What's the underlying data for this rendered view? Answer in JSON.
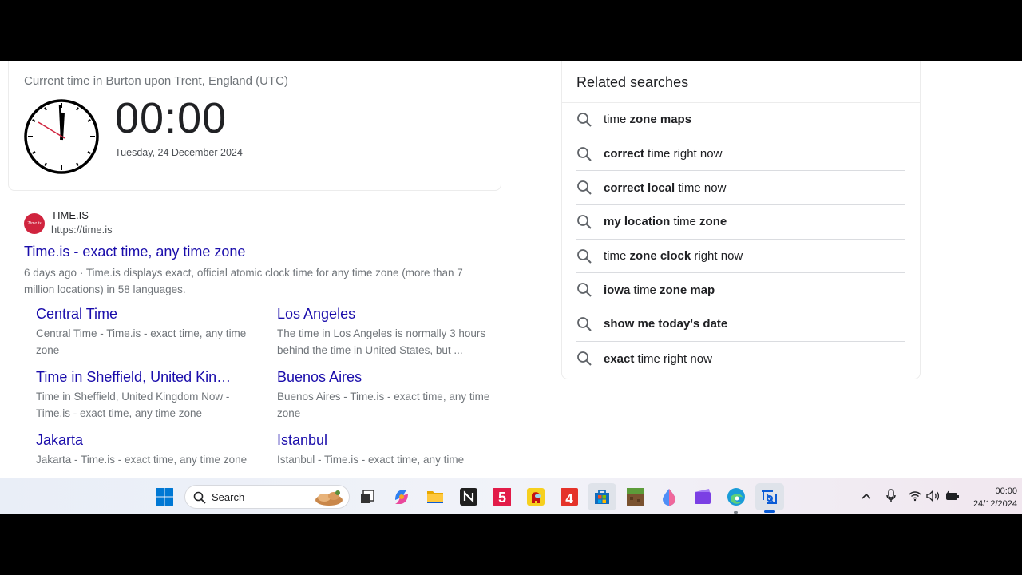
{
  "clock": {
    "location": "Current time in Burton upon Trent, England (UTC)",
    "time": "00:00",
    "date": "Tuesday, 24 December 2024"
  },
  "result": {
    "favicon_text": "Time.is",
    "site_name": "TIME.IS",
    "url": "https://time.is",
    "title": "Time.is - exact time, any time zone",
    "date": "6 days ago",
    "snippet": " · Time.is displays exact, official atomic clock time for any time zone (more than 7 million locations) in 58 languages."
  },
  "sitelinks": [
    {
      "title": "Central Time",
      "desc": "Central Time - Time.is - exact time, any time zone"
    },
    {
      "title": "Los Angeles",
      "desc": "The time in Los Angeles is normally 3 hours behind the time in United States, but ..."
    },
    {
      "title": "Time in Sheffield, United Kingdom",
      "desc": "Time in Sheffield, United Kingdom Now - Time.is - exact time, any time zone"
    },
    {
      "title": "Buenos Aires",
      "desc": "Buenos Aires - Time.is - exact time, any time zone"
    },
    {
      "title": "Jakarta",
      "desc": "Jakarta - Time.is - exact time, any time zone"
    },
    {
      "title": "Istanbul",
      "desc": "Istanbul - Time.is - exact time, any time"
    }
  ],
  "related": {
    "heading": "Related searches",
    "items": [
      [
        {
          "t": "time ",
          "b": false
        },
        {
          "t": "zone maps",
          "b": true
        }
      ],
      [
        {
          "t": "correct",
          "b": true
        },
        {
          "t": " time right now",
          "b": false
        }
      ],
      [
        {
          "t": "correct local",
          "b": true
        },
        {
          "t": " time now",
          "b": false
        }
      ],
      [
        {
          "t": "my location",
          "b": true
        },
        {
          "t": " time ",
          "b": false
        },
        {
          "t": "zone",
          "b": true
        }
      ],
      [
        {
          "t": "time ",
          "b": false
        },
        {
          "t": "zone clock",
          "b": true
        },
        {
          "t": " right now",
          "b": false
        }
      ],
      [
        {
          "t": "iowa",
          "b": true
        },
        {
          "t": " time ",
          "b": false
        },
        {
          "t": "zone map",
          "b": true
        }
      ],
      [
        {
          "t": "show me today's date",
          "b": true
        }
      ],
      [
        {
          "t": "exact",
          "b": true
        },
        {
          "t": " time right now",
          "b": false
        }
      ]
    ]
  },
  "taskbar": {
    "search_label": "Search",
    "time": "00:00",
    "date": "24/12/2024",
    "apps": [
      "start-icon",
      "task-view-icon",
      "copilot-icon",
      "file-explorer-icon",
      "notion-icon",
      "channel5-icon",
      "among-us-icon",
      "times-tables-icon",
      "microsoft-store-icon",
      "minecraft-icon",
      "paint-icon",
      "clipchamp-icon",
      "edge-icon",
      "snipping-tool-icon"
    ]
  },
  "colors": {
    "link": "#1a0dab",
    "accent": "#0a5bd6",
    "favicon": "#d0243e"
  }
}
